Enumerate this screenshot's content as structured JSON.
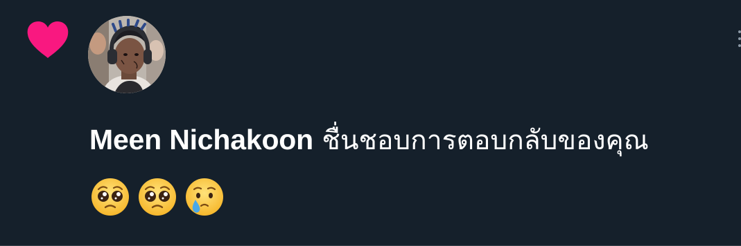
{
  "notification": {
    "icon": "heart-icon",
    "icon_color": "#f91880",
    "user_name": "Meen Nichakoon",
    "action_text": " ชื่นชอบการตอบกลับของคุณ",
    "reply_emojis": [
      "pleading-face-emoji",
      "pleading-face-emoji",
      "face-holding-back-tears-emoji"
    ]
  },
  "colors": {
    "background": "#15202b",
    "text": "#ffffff",
    "divider": "#38444d"
  }
}
